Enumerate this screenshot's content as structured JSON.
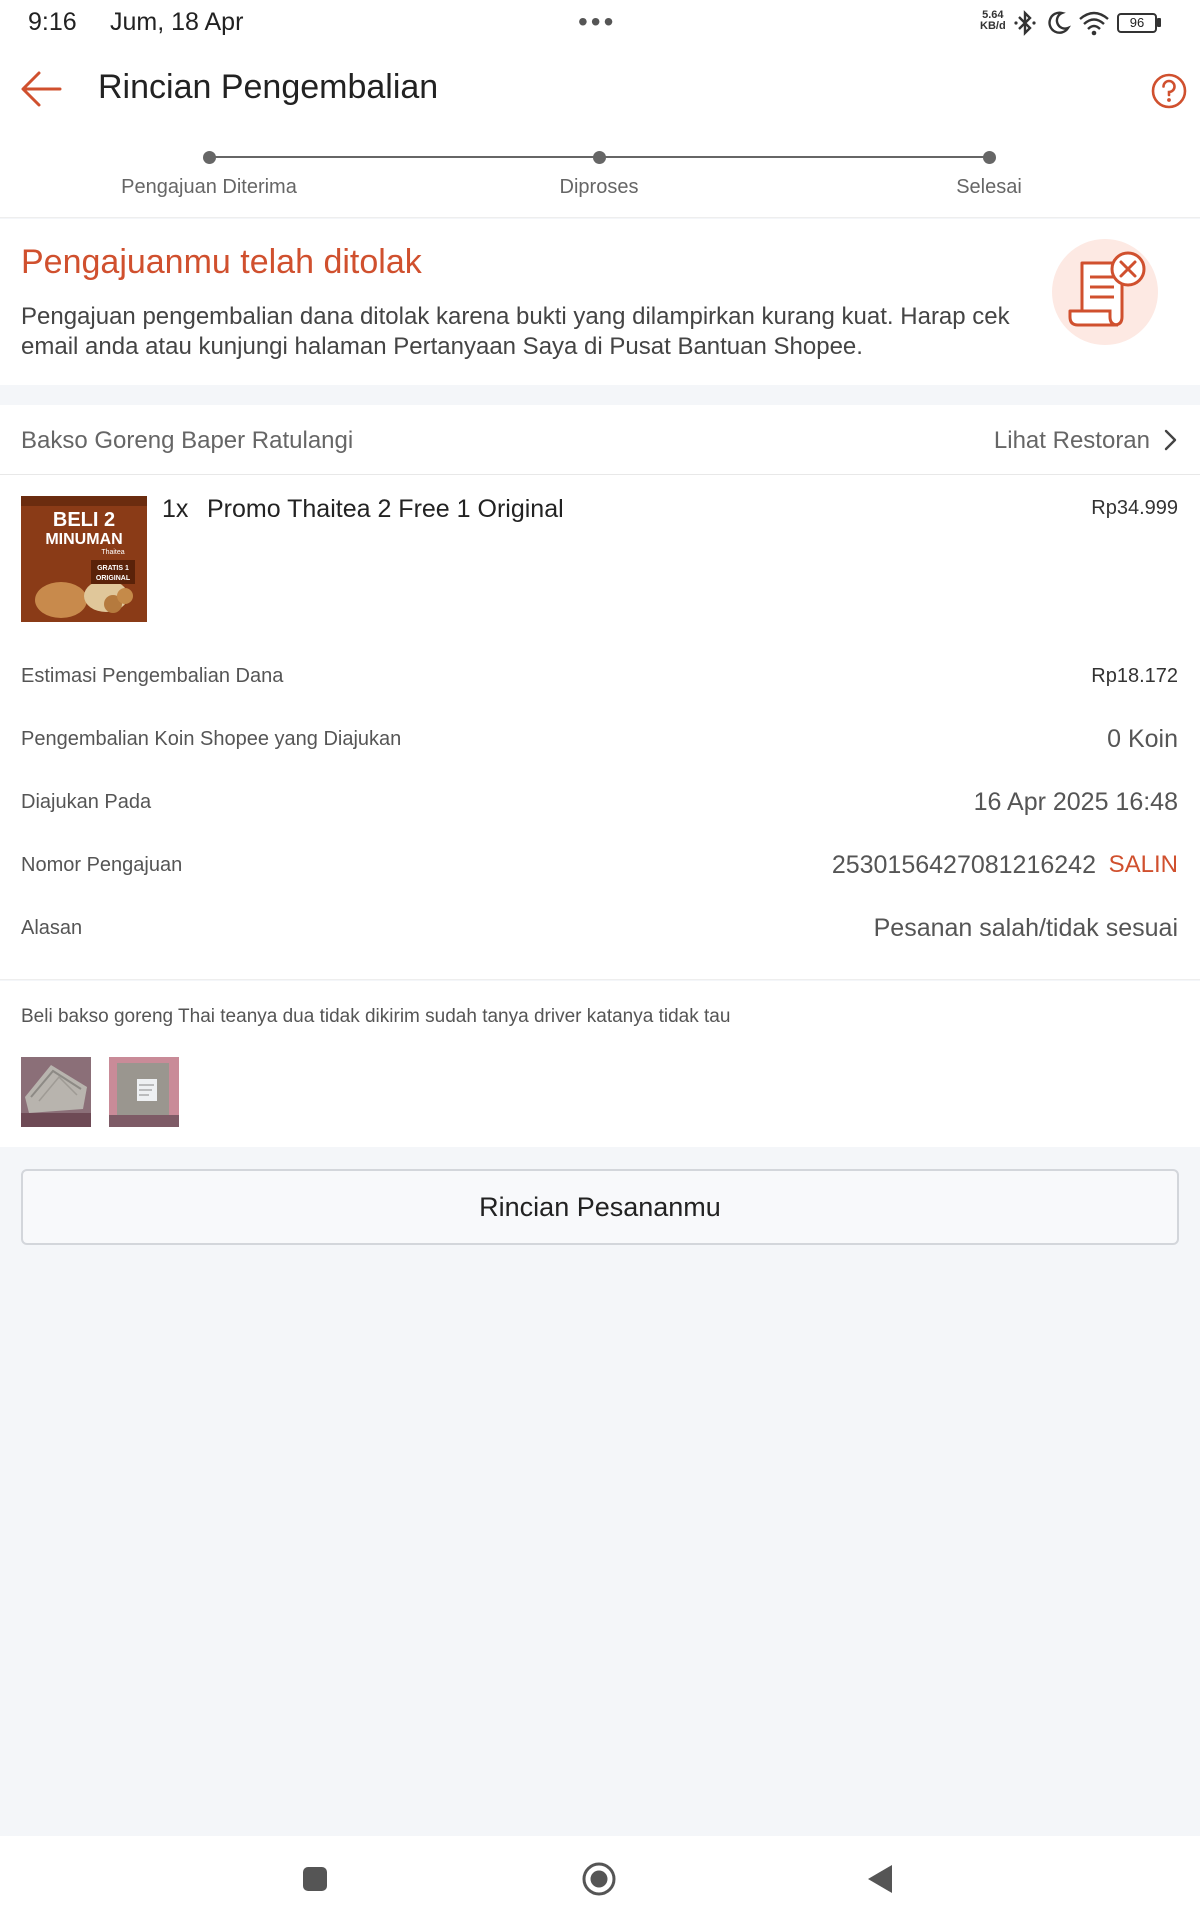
{
  "status_bar": {
    "time": "9:16",
    "date": "Jum, 18 Apr",
    "net_speed_value": "5.64",
    "net_speed_unit": "KB/d",
    "battery": "96",
    "icons": [
      "bluetooth-icon",
      "moon-icon",
      "wifi-icon",
      "battery-icon"
    ]
  },
  "header": {
    "title": "Rincian Pengembalian",
    "back_icon": "arrow-left-icon",
    "help_icon": "question-circle-icon"
  },
  "progress": {
    "steps": [
      {
        "label": "Pengajuan Diterima"
      },
      {
        "label": "Diproses"
      },
      {
        "label": "Selesai"
      }
    ]
  },
  "status_card": {
    "headline": "Pengajuanmu telah ditolak",
    "description": "Pengajuan pengembalian dana ditolak karena bukti yang dilampirkan kurang kuat. Harap cek email anda atau kunjungi halaman Pertanyaan Saya di Pusat Bantuan Shopee.",
    "illustration_icon": "rejected-document-icon"
  },
  "restaurant": {
    "name": "Bakso Goreng Baper Ratulangi",
    "link_label": "Lihat Restoran"
  },
  "item": {
    "image_text": {
      "line1": "BELI 2",
      "line2": "MINUMAN",
      "line3": "Thaitea",
      "badge1": "GRATIS 1",
      "badge2": "ORIGINAL"
    },
    "quantity": "1x",
    "name": "Promo Thaitea 2 Free 1 Original",
    "price": "Rp34.999"
  },
  "details": {
    "rows": [
      {
        "label": "Estimasi Pengembalian Dana",
        "value": "Rp18.172"
      },
      {
        "label": "Pengembalian Koin Shopee yang Diajukan",
        "value": "0 Koin"
      },
      {
        "label": "Diajukan Pada",
        "value": "16 Apr 2025 16:48"
      },
      {
        "label": "Nomor Pengajuan",
        "value": "2530156427081216242"
      },
      {
        "label": "Alasan",
        "value": "Pesanan salah/tidak sesuai"
      }
    ],
    "copy_label": "SALIN"
  },
  "note": {
    "text": "Beli bakso goreng Thai teanya dua tidak dikirim sudah tanya driver katanya tidak tau",
    "photos": [
      "evidence-photo-1",
      "evidence-photo-2"
    ]
  },
  "order_button": {
    "label": "Rincian Pesananmu"
  },
  "colors": {
    "accent": "#d0502e",
    "background": "#f4f6f9",
    "card": "#ffffff"
  }
}
